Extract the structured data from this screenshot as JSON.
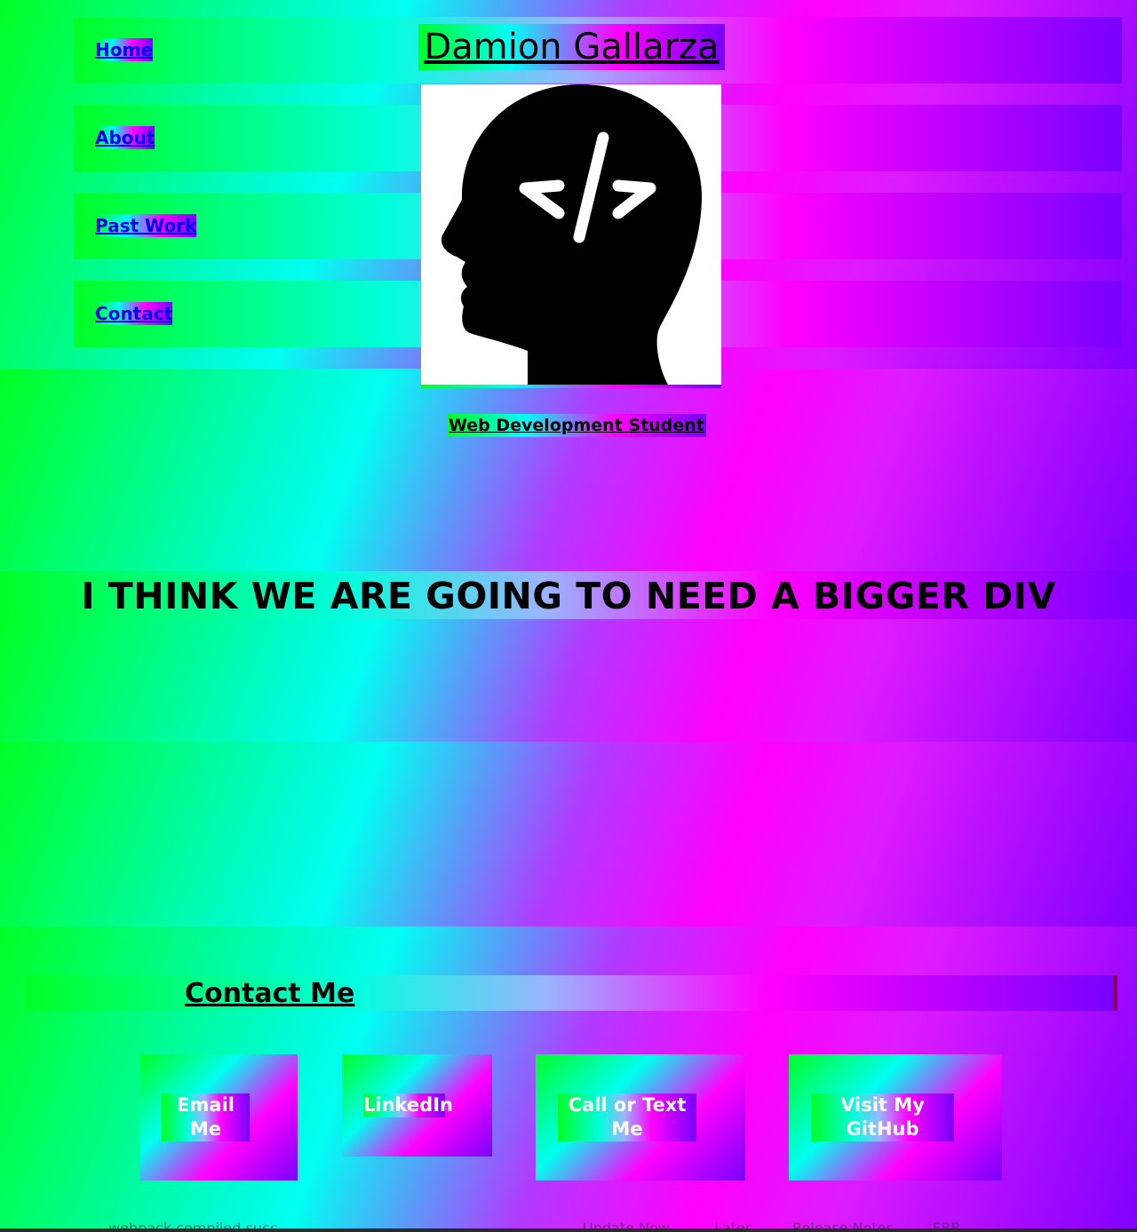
{
  "header": {
    "site_name": "Damion Gallarza",
    "nav": [
      {
        "label": "Home"
      },
      {
        "label": "About"
      },
      {
        "label": "Past Work"
      },
      {
        "label": "Contact"
      }
    ],
    "profile_image_icon": "head-code-icon",
    "subtitle": "Web Development Student"
  },
  "banner": {
    "text": "I THINK WE ARE GOING TO NEED A BIGGER DIV"
  },
  "contact": {
    "heading": "Contact Me",
    "cards": [
      {
        "label": "Email Me"
      },
      {
        "label": "LinkedIn"
      },
      {
        "label": "Call or Text Me"
      },
      {
        "label": "Visit My GitHub"
      }
    ]
  },
  "background": {
    "gradient_colors": [
      "#00ff26",
      "#00fff2",
      "#ff00ff",
      "#7f00ff"
    ]
  },
  "taskbar_fragments": [
    "webpack compiled succ",
    "Update Now",
    "Later",
    "Release Notes",
    "FBB"
  ]
}
